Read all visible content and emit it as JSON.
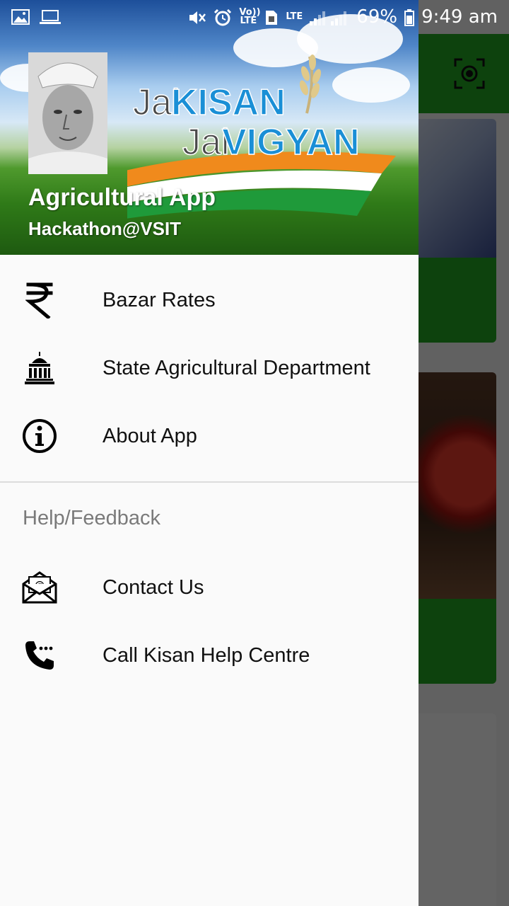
{
  "status_bar": {
    "battery_percent": "69%",
    "time": "9:49 am",
    "volte_label": "Vo)) LTE",
    "lte_label": "LTE"
  },
  "drawer": {
    "header": {
      "logo_line1_a": "Jai",
      "logo_line1_b": "KISAN",
      "logo_line2_a": "Jai",
      "logo_line2_b": "VIGYAN",
      "app_name": "Agricultural App",
      "subtitle": "Hackathon@VSIT"
    },
    "items": [
      {
        "label": "Bazar Rates",
        "icon": "rupee-icon"
      },
      {
        "label": "State Agricultural Department",
        "icon": "government-building-icon"
      },
      {
        "label": "About App",
        "icon": "info-icon"
      }
    ],
    "section_title": "Help/Feedback",
    "help_items": [
      {
        "label": "Contact Us",
        "icon": "email-envelope-icon"
      },
      {
        "label": "Call Kisan Help Centre",
        "icon": "phone-call-icon"
      }
    ]
  },
  "colors": {
    "toolbar_green": "#22a622",
    "saffron": "#f08a1c",
    "india_green": "#1f9a3a",
    "logo_blue": "#1a8fd6"
  }
}
